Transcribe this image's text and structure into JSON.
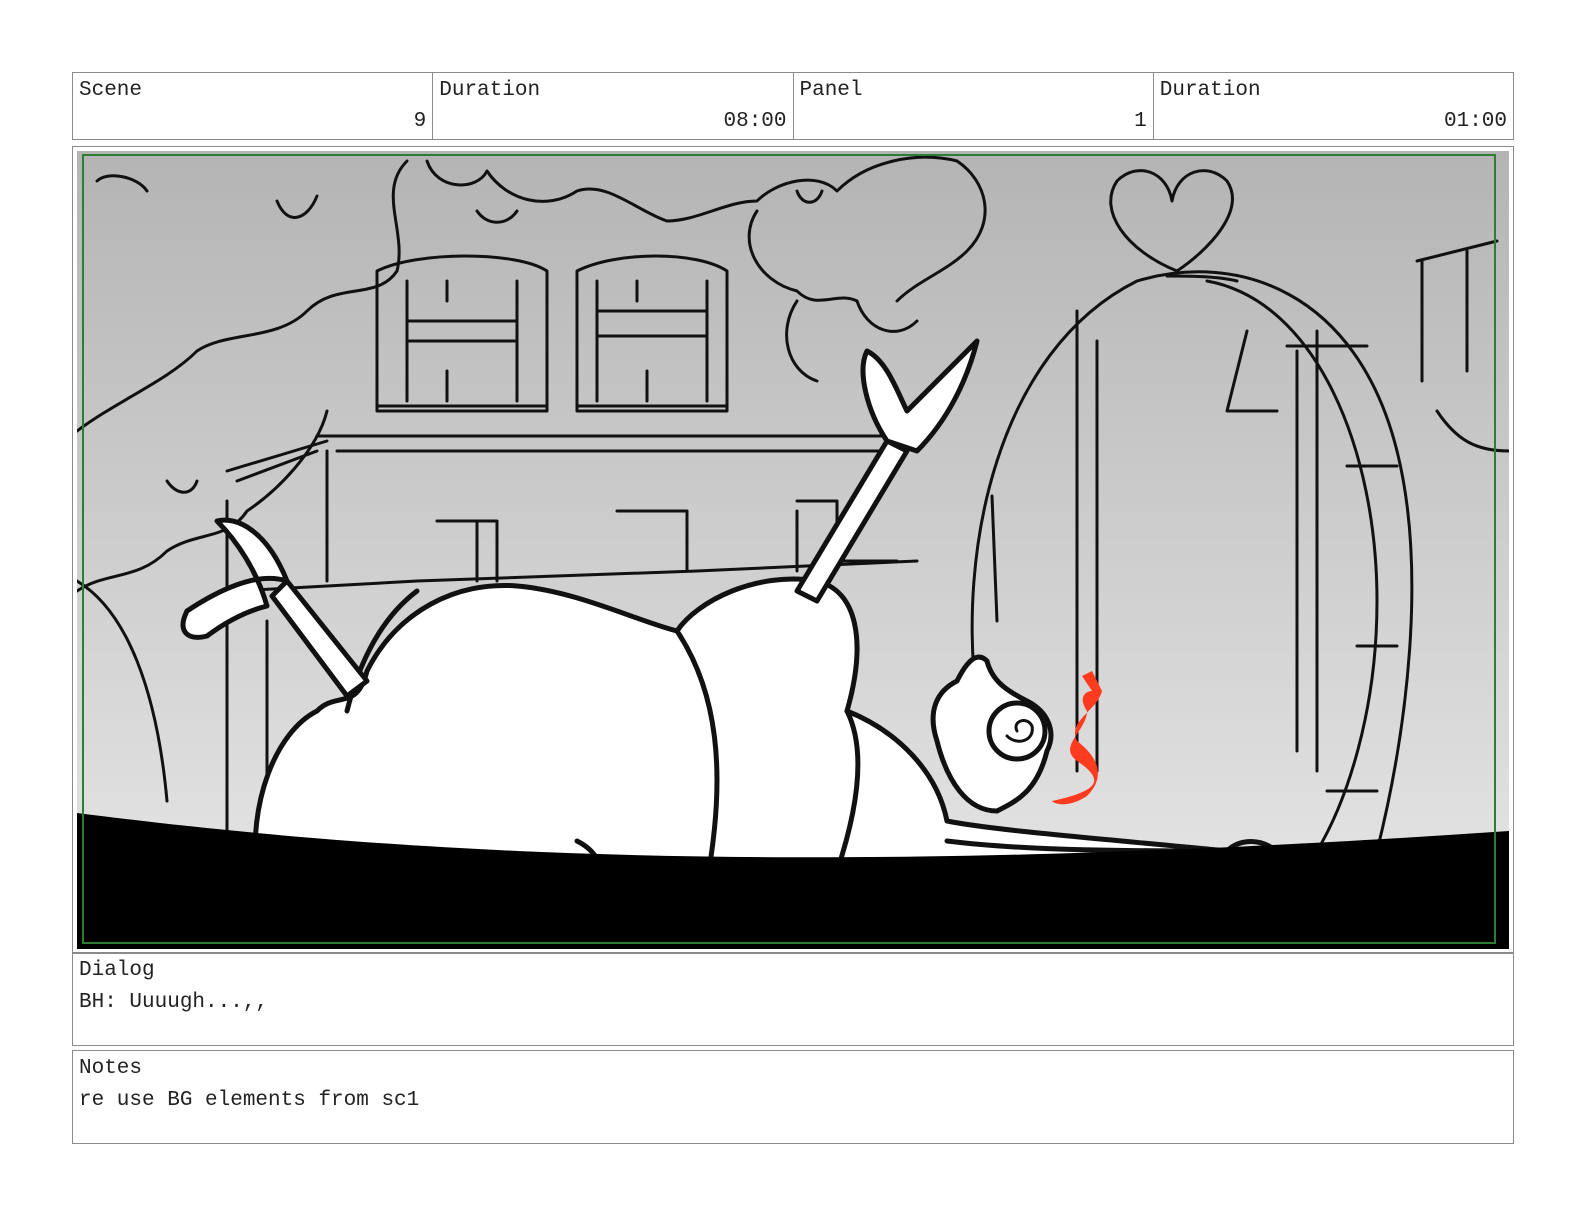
{
  "header": {
    "scene_label": "Scene",
    "scene_value": "9",
    "scene_duration_label": "Duration",
    "scene_duration_value": "08:00",
    "panel_label": "Panel",
    "panel_value": "1",
    "panel_duration_label": "Duration",
    "panel_duration_value": "01:00"
  },
  "panel_image": {
    "description_icon": "storyboard-sketch",
    "safe_frame_color": "#2e7d32",
    "accent_color": "#ff3b1f"
  },
  "dialog": {
    "label": "Dialog",
    "text": "BH: Uuuugh...,,"
  },
  "notes": {
    "label": "Notes",
    "text": "re use BG elements from sc1"
  }
}
